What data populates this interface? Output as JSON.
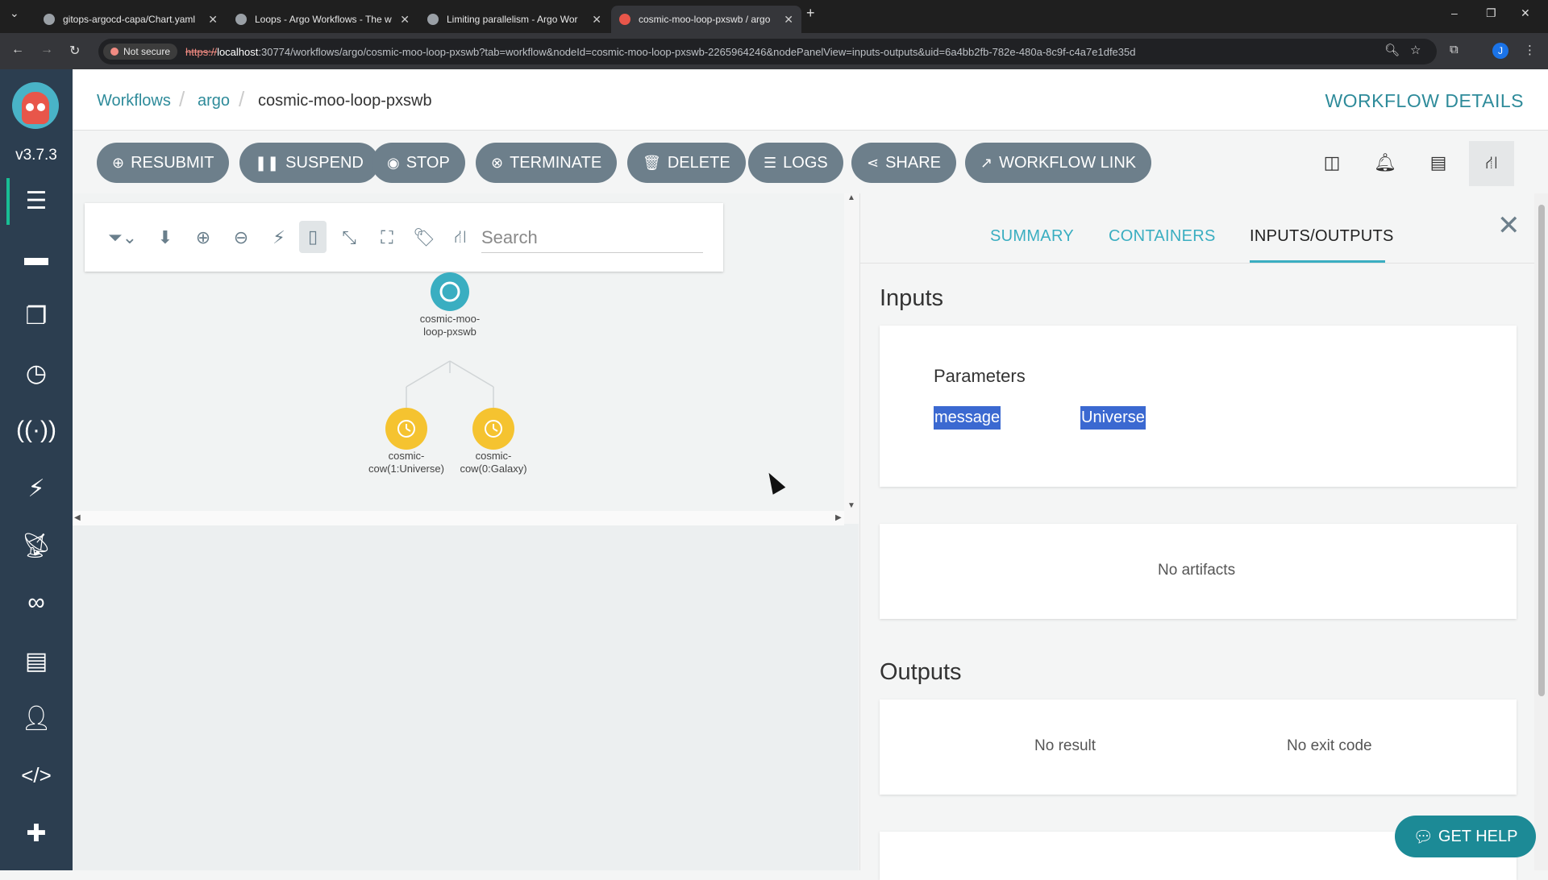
{
  "browser": {
    "tabs": [
      {
        "title": "gitops-argocd-capa/Chart.yaml",
        "active": false
      },
      {
        "title": "Loops - Argo Workflows - The w",
        "active": false
      },
      {
        "title": "Limiting parallelism - Argo Wor",
        "active": false
      },
      {
        "title": "cosmic-moo-loop-pxswb / argo",
        "active": true
      }
    ],
    "security_label": "Not secure",
    "url_scheme": "https://",
    "url_host": "localhost",
    "url_rest": ":30774/workflows/argo/cosmic-moo-loop-pxswb?tab=workflow&nodeId=cosmic-moo-loop-pxswb-2265964246&nodePanelView=inputs-outputs&uid=6a4bb2fb-782e-480a-8c9f-c4a7e1dfe35d",
    "profile_initial": "J"
  },
  "sidebar": {
    "version": "v3.7.3",
    "items": [
      {
        "icon": "menu-icon"
      },
      {
        "icon": "workflow-icon"
      },
      {
        "icon": "templates-icon"
      },
      {
        "icon": "clock-icon"
      },
      {
        "icon": "event-source-icon"
      },
      {
        "icon": "bolt-icon"
      },
      {
        "icon": "satellite-icon"
      },
      {
        "icon": "link-icon"
      },
      {
        "icon": "reports-icon"
      },
      {
        "icon": "user-icon"
      },
      {
        "icon": "code-icon"
      },
      {
        "icon": "plugin-icon"
      }
    ]
  },
  "breadcrumb": {
    "items": [
      "Workflows",
      "argo",
      "cosmic-moo-loop-pxswb"
    ]
  },
  "page_title": "WORKFLOW DETAILS",
  "actions": {
    "resubmit": "RESUBMIT",
    "suspend": "SUSPEND",
    "stop": "STOP",
    "terminate": "TERMINATE",
    "delete": "DELETE",
    "logs": "LOGS",
    "share": "SHARE",
    "workflow_link": "WORKFLOW LINK"
  },
  "graph": {
    "search_placeholder": "Search",
    "root": {
      "label_line1": "cosmic-moo-",
      "label_line2": "loop-pxswb"
    },
    "children": [
      {
        "label_line1": "cosmic-",
        "label_line2": "cow(1:Universe)"
      },
      {
        "label_line1": "cosmic-",
        "label_line2": "cow(0:Galaxy)"
      }
    ]
  },
  "details": {
    "tabs": [
      "SUMMARY",
      "CONTAINERS",
      "INPUTS/OUTPUTS"
    ],
    "active_tab": "INPUTS/OUTPUTS",
    "inputs_title": "Inputs",
    "parameters_title": "Parameters",
    "parameter": {
      "name": "message",
      "value": "Universe"
    },
    "artifacts_text": "No artifacts",
    "outputs_title": "Outputs",
    "no_result": "No result",
    "no_exit_code": "No exit code"
  },
  "help_button": "GET HELP",
  "colors": {
    "sidebar": "#2c3e50",
    "accent": "#2e8b9a",
    "action_button": "#6d7f8b",
    "running_node": "#3aaec1",
    "pending_node": "#f5c330",
    "highlight": "#3b69d1"
  }
}
